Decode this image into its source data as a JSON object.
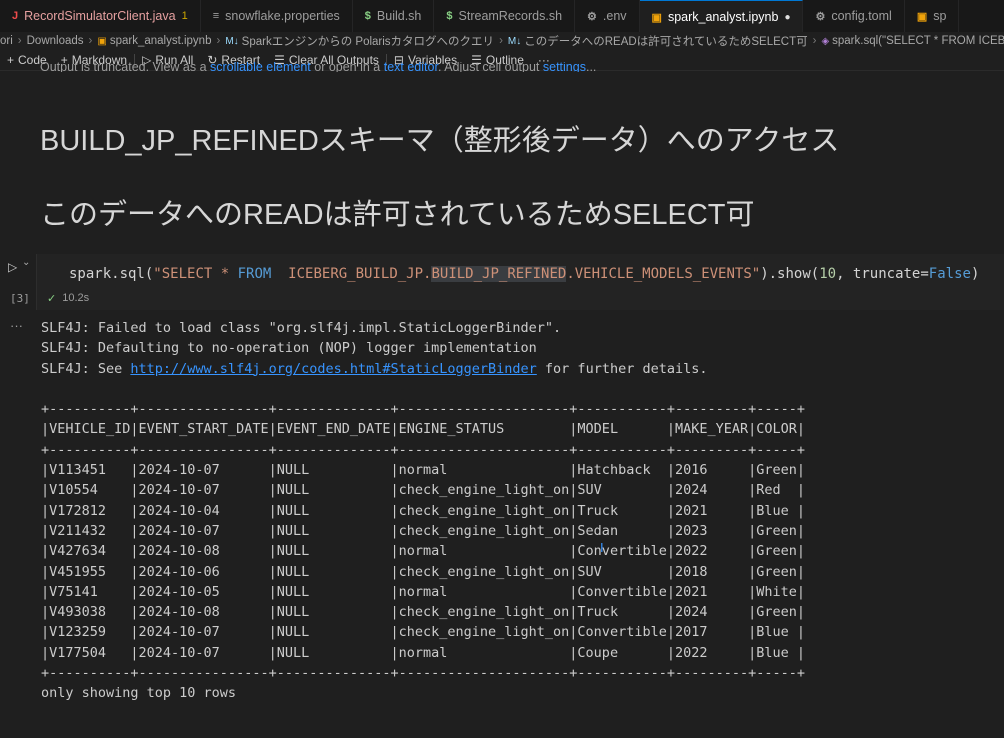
{
  "tabs": [
    {
      "icon": "J",
      "icon_color": "#f14c4c",
      "label": "RecordSimulatorClient.java",
      "badge": "1"
    },
    {
      "icon": "≡",
      "icon_color": "#9d9d9d",
      "label": "snowflake.properties"
    },
    {
      "icon": "$",
      "icon_color": "#89d185",
      "label": "Build.sh"
    },
    {
      "icon": "$",
      "icon_color": "#89d185",
      "label": "StreamRecords.sh"
    },
    {
      "icon": "⚙",
      "icon_color": "#9d9d9d",
      "label": ".env"
    },
    {
      "icon": "▣",
      "icon_color": "#f0a30a",
      "label": "spark_analyst.ipynb",
      "dirty": "●"
    },
    {
      "icon": "⚙",
      "icon_color": "#9d9d9d",
      "label": "config.toml"
    },
    {
      "icon": "▣",
      "icon_color": "#f0a30a",
      "label": "sp"
    }
  ],
  "breadcrumbs": [
    "ori",
    "Downloads",
    "spark_analyst.ipynb",
    "Sparkエンジンからの Polarisカタログへのクエリ",
    "このデータへのREADは許可されているためSELECT可",
    "spark.sql(\"SELECT * FROM  ICEBERG_BUI"
  ],
  "breadcrumb_icons": {
    "md": "M↓",
    "fn": "◈"
  },
  "toolbar": {
    "code": "Code",
    "markdown": "Markdown",
    "run_all": "Run All",
    "restart": "Restart",
    "clear_outputs": "Clear All Outputs",
    "variables": "Variables",
    "outline": "Outline",
    "more": "···"
  },
  "cut_text": {
    "prefix": "Output is truncated. View as a ",
    "link1": "scrollable element",
    "mid": " or open in a ",
    "link2": "text editor",
    "suffix": ". Adjust cell output ",
    "link3": "settings",
    "end": "..."
  },
  "markdown": {
    "heading1": "BUILD_JP_REFINEDスキーマ（整形後データ）へのアクセス",
    "heading2": "このデータへのREADは許可されているためSELECT可"
  },
  "cell": {
    "exec_count": "[3]",
    "status_time": "10.2s",
    "code_parts": {
      "fn": "spark.sql(",
      "str_a": "\"SELECT ",
      "star": "* ",
      "from": "FROM",
      "str_b": "  ICEBERG_BUILD_JP.",
      "hl": "BUILD_JP_REFINED",
      "str_c": ".VEHICLE_MODELS_EVENTS\"",
      "mid": ").show(",
      "num": "10",
      "comma": ", truncate=",
      "bool": "False",
      "close": ")"
    }
  },
  "output": {
    "dots": "···",
    "log1": "SLF4J: Failed to load class \"org.slf4j.impl.StaticLoggerBinder\".",
    "log2": "SLF4J: Defaulting to no-operation (NOP) logger implementation",
    "log3_prefix": "SLF4J: See ",
    "log3_link": "http://www.slf4j.org/codes.html#StaticLoggerBinder",
    "log3_suffix": " for further details.",
    "border": "+----------+----------------+--------------+---------------------+-----------+---------+-----+",
    "header": "|VEHICLE_ID|EVENT_START_DATE|EVENT_END_DATE|ENGINE_STATUS        |MODEL      |MAKE_YEAR|COLOR|",
    "rows": [
      "|V113451   |2024-10-07      |NULL          |normal               |Hatchback  |2016     |Green|",
      "|V10554    |2024-10-07      |NULL          |check_engine_light_on|SUV        |2024     |Red  |",
      "|V172812   |2024-10-04      |NULL          |check_engine_light_on|Truck      |2021     |Blue |",
      "|V211432   |2024-10-07      |NULL          |check_engine_light_on|Sedan      |2023     |Green|",
      "|V427634   |2024-10-08      |NULL          |normal               |Convertible|2022     |Green|",
      "|V451955   |2024-10-06      |NULL          |check_engine_light_on|SUV        |2018     |Green|",
      "|V75141    |2024-10-05      |NULL          |normal               |Convertible|2021     |White|",
      "|V493038   |2024-10-08      |NULL          |check_engine_light_on|Truck      |2024     |Green|",
      "|V123259   |2024-10-07      |NULL          |check_engine_light_on|Convertible|2017     |Blue |",
      "|V177504   |2024-10-07      |NULL          |normal               |Coupe      |2022     |Blue |"
    ],
    "footer": "only showing top 10 rows"
  },
  "colors": {
    "accent": "#0078d4",
    "link": "#3794ff",
    "string": "#ce9178",
    "keyword": "#569cd6",
    "number": "#b5cea8"
  }
}
